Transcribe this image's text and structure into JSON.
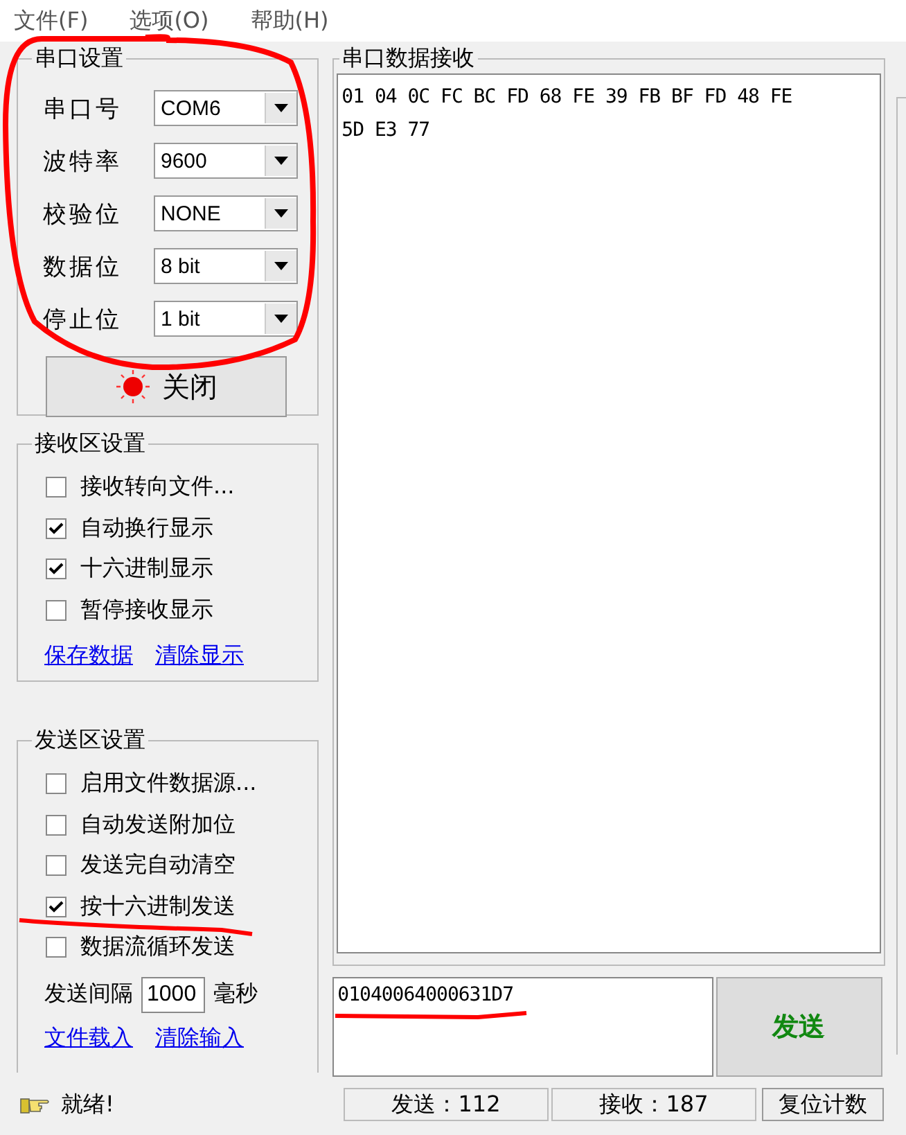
{
  "menu": [
    {
      "label": "文件(F)"
    },
    {
      "label": "选项(O)"
    },
    {
      "label": "帮助(H)"
    }
  ],
  "serial_settings": {
    "title": "串口设置",
    "fields": [
      {
        "label": "串口号",
        "value": "COM6"
      },
      {
        "label": "波特率",
        "value": "9600"
      },
      {
        "label": "校验位",
        "value": "NONE"
      },
      {
        "label": "数据位",
        "value": "8 bit"
      },
      {
        "label": "停止位",
        "value": "1 bit"
      }
    ],
    "button": {
      "label": "关闭",
      "lamp_on": true
    }
  },
  "receive_settings": {
    "title": "接收区设置",
    "options": [
      {
        "label": "接收转向文件...",
        "checked": false
      },
      {
        "label": "自动换行显示",
        "checked": true
      },
      {
        "label": "十六进制显示",
        "checked": true
      },
      {
        "label": "暂停接收显示",
        "checked": false
      }
    ],
    "links": [
      "保存数据",
      "清除显示"
    ]
  },
  "send_settings": {
    "title": "发送区设置",
    "options": [
      {
        "label": "启用文件数据源...",
        "checked": false
      },
      {
        "label": "自动发送附加位",
        "checked": false
      },
      {
        "label": "发送完自动清空",
        "checked": false
      },
      {
        "label": "按十六进制发送",
        "checked": true
      },
      {
        "label": "数据流循环发送",
        "checked": false
      }
    ],
    "interval": {
      "label": "发送间隔",
      "value": "1000",
      "unit": "毫秒"
    },
    "links": [
      "文件载入",
      "清除输入"
    ]
  },
  "receive": {
    "title": "串口数据接收",
    "lines": [
      "01 04 0C FC BC FD 68 FE 39 FB BF FD 48 FE",
      "5D E3 77"
    ]
  },
  "send": {
    "value": "01040064000631D7",
    "button": "发送"
  },
  "status": {
    "message": "就绪!",
    "sent": "发送：112",
    "received": "接收：187",
    "reset": "复位计数"
  }
}
